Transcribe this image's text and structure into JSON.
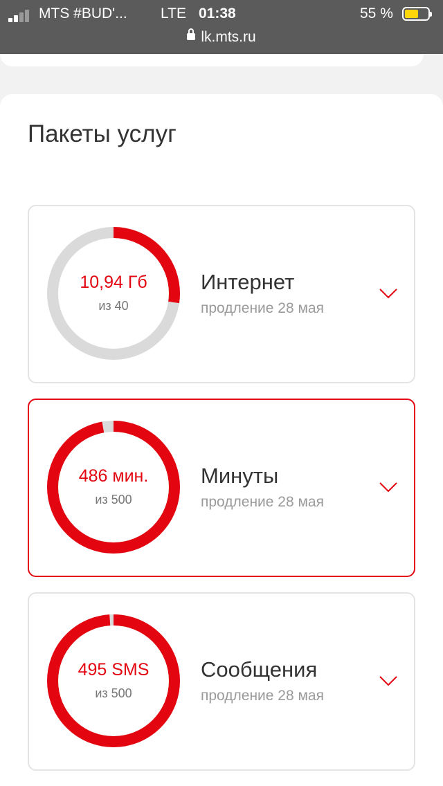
{
  "status_bar": {
    "carrier": "MTS #BUD'...",
    "network": "LTE",
    "time": "01:38",
    "battery_percent": "55 %",
    "url": "lk.mts.ru"
  },
  "colors": {
    "accent": "#e30611",
    "track": "#dadada",
    "status_bar": "#5b5b5b"
  },
  "section": {
    "title": "Пакеты услуг"
  },
  "packages": [
    {
      "name": "Интернет",
      "value": "10,94 Гб",
      "total": "из 40",
      "renewal": "продление 28 мая",
      "fraction": 0.2735,
      "active": false
    },
    {
      "name": "Минуты",
      "value": "486 мин.",
      "total": "из 500",
      "renewal": "продление 28 мая",
      "fraction": 0.972,
      "active": true
    },
    {
      "name": "Сообщения",
      "value": "495 SMS",
      "total": "из 500",
      "renewal": "продление 28 мая",
      "fraction": 0.99,
      "active": false
    }
  ]
}
